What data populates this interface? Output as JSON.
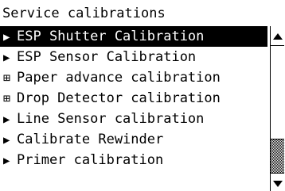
{
  "screen": {
    "title": "Service calibrations"
  },
  "menu": {
    "items": [
      {
        "icon": "▶",
        "icon_name": "arrow-right-icon",
        "label": "ESP Shutter Calibration",
        "selected": true
      },
      {
        "icon": "▶",
        "icon_name": "arrow-right-icon",
        "label": "ESP Sensor Calibration",
        "selected": false
      },
      {
        "icon": "⊞",
        "icon_name": "expand-plus-icon",
        "label": "Paper advance calibration",
        "selected": false
      },
      {
        "icon": "⊞",
        "icon_name": "expand-plus-icon",
        "label": "Drop Detector calibration",
        "selected": false
      },
      {
        "icon": "▶",
        "icon_name": "arrow-right-icon",
        "label": "Line Sensor calibration",
        "selected": false
      },
      {
        "icon": "▶",
        "icon_name": "arrow-right-icon",
        "label": "Calibrate Rewinder",
        "selected": false
      },
      {
        "icon": "▶",
        "icon_name": "arrow-right-icon",
        "label": "Primer calibration",
        "selected": false
      }
    ]
  },
  "scrollbar": {
    "up_arrow": "▲",
    "down_arrow": "▼"
  },
  "colors": {
    "selected_background": "#000000",
    "selected_text": "#ffffff",
    "background": "#ffffff",
    "text": "#000000"
  }
}
